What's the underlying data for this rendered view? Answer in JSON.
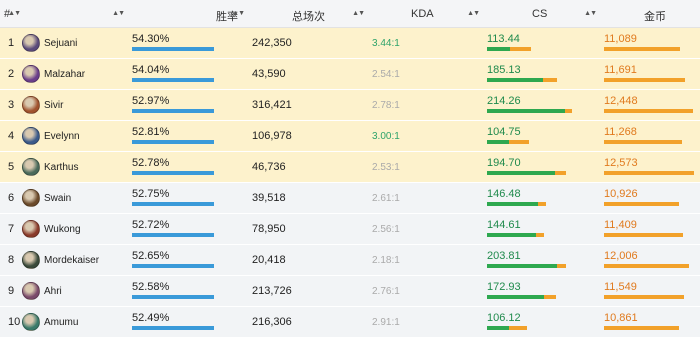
{
  "header": {
    "rank": "#",
    "winrate": "胜率",
    "games": "总场次",
    "kda": "KDA",
    "cs": "CS",
    "gold": "金币",
    "sort_icon": "sort-icon"
  },
  "colors": {
    "winrate_bar": "#3a9ad9",
    "cs_bar_green": "#2ea84f",
    "cs_bar_orange": "#f2a12a",
    "gold_bar": "#f2a12a",
    "kda_high": "#2ea36a",
    "kda_low": "#aaaaaa",
    "top_row_bg": "#fdf2cc",
    "rest_row_bg": "#f2f4f6"
  },
  "rows": [
    {
      "rank": "1",
      "name": "Sejuani",
      "winrate": "54.30%",
      "winrate_fill": 0.91,
      "games": "242,350",
      "kda": "3.44:1",
      "kda_high": true,
      "cs": "113.44",
      "cs_green": 0.25,
      "cs_orange": 0.24,
      "gold": "11,089",
      "gold_fill": 0.83,
      "avatar_color": "#5a4a7a"
    },
    {
      "rank": "2",
      "name": "Malzahar",
      "winrate": "54.04%",
      "winrate_fill": 0.91,
      "games": "43,590",
      "kda": "2.54:1",
      "kda_high": false,
      "cs": "185.13",
      "cs_green": 0.62,
      "cs_orange": 0.16,
      "gold": "11,691",
      "gold_fill": 0.88,
      "avatar_color": "#6a3e8a"
    },
    {
      "rank": "3",
      "name": "Sivir",
      "winrate": "52.97%",
      "winrate_fill": 0.91,
      "games": "316,421",
      "kda": "2.78:1",
      "kda_high": false,
      "cs": "214.26",
      "cs_green": 0.87,
      "cs_orange": 0.08,
      "gold": "12,448",
      "gold_fill": 0.97,
      "avatar_color": "#a0522d"
    },
    {
      "rank": "4",
      "name": "Evelynn",
      "winrate": "52.81%",
      "winrate_fill": 0.91,
      "games": "106,978",
      "kda": "3.00:1",
      "kda_high": true,
      "cs": "104.75",
      "cs_green": 0.24,
      "cs_orange": 0.23,
      "gold": "11,268",
      "gold_fill": 0.85,
      "avatar_color": "#3b5a8a"
    },
    {
      "rank": "5",
      "name": "Karthus",
      "winrate": "52.78%",
      "winrate_fill": 0.91,
      "games": "46,736",
      "kda": "2.53:1",
      "kda_high": false,
      "cs": "194.70",
      "cs_green": 0.76,
      "cs_orange": 0.12,
      "gold": "12,573",
      "gold_fill": 0.98,
      "avatar_color": "#4a6a5a"
    },
    {
      "rank": "6",
      "name": "Swain",
      "winrate": "52.75%",
      "winrate_fill": 0.91,
      "games": "39,518",
      "kda": "2.61:1",
      "kda_high": false,
      "cs": "146.48",
      "cs_green": 0.57,
      "cs_orange": 0.09,
      "gold": "10,926",
      "gold_fill": 0.82,
      "avatar_color": "#6b4a2a"
    },
    {
      "rank": "7",
      "name": "Wukong",
      "winrate": "52.72%",
      "winrate_fill": 0.91,
      "games": "78,950",
      "kda": "2.56:1",
      "kda_high": false,
      "cs": "144.61",
      "cs_green": 0.54,
      "cs_orange": 0.09,
      "gold": "11,409",
      "gold_fill": 0.86,
      "avatar_color": "#8a3a2a"
    },
    {
      "rank": "8",
      "name": "Mordekaiser",
      "winrate": "52.65%",
      "winrate_fill": 0.91,
      "games": "20,418",
      "kda": "2.18:1",
      "kda_high": false,
      "cs": "203.81",
      "cs_green": 0.78,
      "cs_orange": 0.1,
      "gold": "12,006",
      "gold_fill": 0.92,
      "avatar_color": "#3a4a3a"
    },
    {
      "rank": "9",
      "name": "Ahri",
      "winrate": "52.58%",
      "winrate_fill": 0.91,
      "games": "213,726",
      "kda": "2.76:1",
      "kda_high": false,
      "cs": "172.93",
      "cs_green": 0.63,
      "cs_orange": 0.14,
      "gold": "11,549",
      "gold_fill": 0.87,
      "avatar_color": "#7a4a6a"
    },
    {
      "rank": "10",
      "name": "Amumu",
      "winrate": "52.49%",
      "winrate_fill": 0.91,
      "games": "216,306",
      "kda": "2.91:1",
      "kda_high": false,
      "cs": "106.12",
      "cs_green": 0.24,
      "cs_orange": 0.21,
      "gold": "10,861",
      "gold_fill": 0.81,
      "avatar_color": "#3a7a6a"
    }
  ]
}
